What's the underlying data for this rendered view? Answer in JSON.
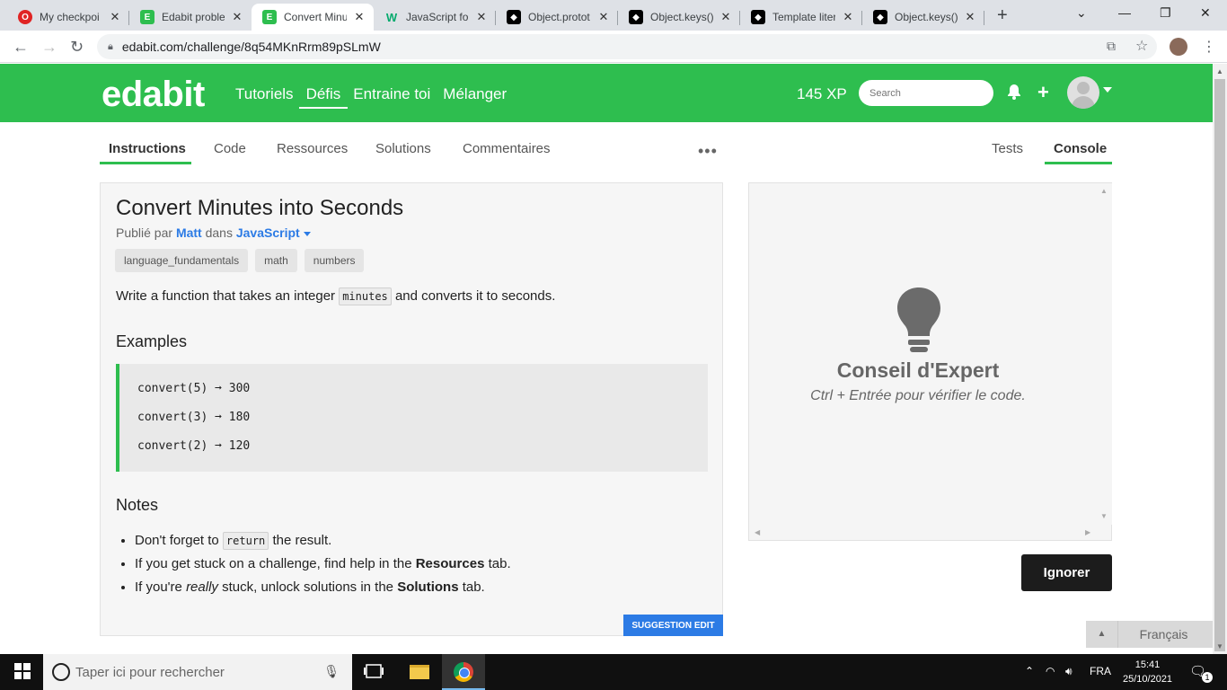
{
  "browser": {
    "tabs": [
      {
        "title": "My checkpoi",
        "icon": "opera-icon",
        "color": "#e02424",
        "active": false
      },
      {
        "title": "Edabit proble",
        "icon": "edabit-icon",
        "color": "#2ebe4f",
        "active": false
      },
      {
        "title": "Convert Minu",
        "icon": "edabit-icon",
        "color": "#2ebe4f",
        "active": true
      },
      {
        "title": "JavaScript for",
        "icon": "w3-icon",
        "color": "#04aa6d",
        "active": false
      },
      {
        "title": "Object.protot",
        "icon": "mdn-icon",
        "color": "#000000",
        "active": false
      },
      {
        "title": "Object.keys()",
        "icon": "mdn-icon",
        "color": "#000000",
        "active": false
      },
      {
        "title": "Template liter",
        "icon": "mdn-icon",
        "color": "#000000",
        "active": false
      },
      {
        "title": "Object.keys()",
        "icon": "mdn-icon",
        "color": "#000000",
        "active": false
      }
    ],
    "url": "edabit.com/challenge/8q54MKnRrm89pSLmW"
  },
  "header": {
    "logo": "edabit",
    "nav": [
      "Tutoriels",
      "Défis",
      "Entraine toi",
      "Mélanger"
    ],
    "active_nav": "Défis",
    "xp": "145 XP",
    "search_placeholder": "Search"
  },
  "subtabs": {
    "left": [
      "Instructions",
      "Code",
      "Ressources",
      "Solutions",
      "Commentaires"
    ],
    "right": [
      "Tests",
      "Console"
    ],
    "more": "•••"
  },
  "challenge": {
    "title": "Convert Minutes into Seconds",
    "published_prefix": "Publié par",
    "author": "Matt",
    "in_word": "dans",
    "language": "JavaScript",
    "tags": [
      "language_fundamentals",
      "math",
      "numbers"
    ],
    "desc_before": "Write a function that takes an integer",
    "desc_code": "minutes",
    "desc_after": "and converts it to seconds.",
    "examples_heading": "Examples",
    "examples": [
      "convert(5) ➞ 300",
      "convert(3) ➞ 180",
      "convert(2) ➞ 120"
    ],
    "notes_heading": "Notes",
    "note1_before": "Don't forget to",
    "note1_code": "return",
    "note1_after": "the result.",
    "note2_before": "If you get stuck on a challenge, find help in the",
    "note2_bold": "Resources",
    "note2_after": "tab.",
    "note3_before": "If you're",
    "note3_em": "really",
    "note3_mid": "stuck, unlock solutions in the",
    "note3_bold": "Solutions",
    "note3_after": "tab.",
    "suggest_button": "SUGGESTION EDIT"
  },
  "console": {
    "tip_title": "Conseil d'Expert",
    "tip_sub": "Ctrl + Entrée pour vérifier le code.",
    "ignore_button": "Ignorer"
  },
  "language_selector": "Français",
  "taskbar": {
    "search_placeholder": "Taper ici pour rechercher",
    "lang": "FRA",
    "time": "15:41",
    "date": "25/10/2021",
    "notification_count": "1"
  },
  "colors": {
    "brand_green": "#2ebe4f",
    "link_blue": "#2c7be5",
    "dark_button": "#1c1c1c"
  }
}
